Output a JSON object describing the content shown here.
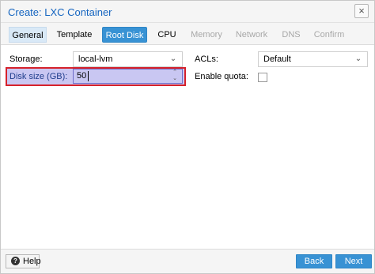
{
  "window": {
    "title": "Create: LXC Container",
    "close_glyph": "×"
  },
  "tabs": [
    {
      "label": "General",
      "state": "visited"
    },
    {
      "label": "Template",
      "state": "enabled"
    },
    {
      "label": "Root Disk",
      "state": "active"
    },
    {
      "label": "CPU",
      "state": "enabled"
    },
    {
      "label": "Memory",
      "state": "disabled"
    },
    {
      "label": "Network",
      "state": "disabled"
    },
    {
      "label": "DNS",
      "state": "disabled"
    },
    {
      "label": "Confirm",
      "state": "disabled"
    }
  ],
  "form": {
    "storage": {
      "label": "Storage:",
      "value": "local-lvm"
    },
    "disk_size": {
      "label": "Disk size (GB):",
      "value": "50"
    },
    "acls": {
      "label": "ACLs:",
      "value": "Default"
    },
    "quota": {
      "label": "Enable quota:",
      "checked": false
    }
  },
  "footer": {
    "help_label": "Help",
    "back_label": "Back",
    "next_label": "Next"
  },
  "colors": {
    "accent": "#3892d4",
    "title": "#1565c0",
    "highlight_border": "#d6212b",
    "focus_fill": "#c9c7f2"
  }
}
